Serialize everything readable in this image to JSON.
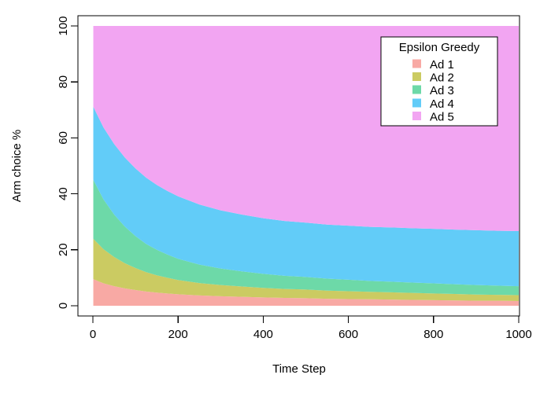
{
  "chart_data": {
    "type": "area",
    "stacked": true,
    "percent": true,
    "title": "",
    "xlabel": "Time Step",
    "ylabel": "Arm choice %",
    "xlim": [
      0,
      1000
    ],
    "ylim": [
      0,
      100
    ],
    "grid": false,
    "xticks": [
      0,
      200,
      400,
      600,
      800,
      1000
    ],
    "yticks": [
      0,
      20,
      40,
      60,
      80,
      100
    ],
    "xtick_labels": [
      "0",
      "200",
      "400",
      "600",
      "800",
      "1000"
    ],
    "ytick_labels": [
      "0",
      "20",
      "40",
      "60",
      "80",
      "100"
    ],
    "legend": {
      "title": "Epsilon Greedy",
      "position": "top-right",
      "entries": [
        {
          "label": "Ad 1",
          "color": "#F8A9A4"
        },
        {
          "label": "Ad 2",
          "color": "#CBCB62"
        },
        {
          "label": "Ad 3",
          "color": "#6DD9A8"
        },
        {
          "label": "Ad 4",
          "color": "#62CCF8"
        },
        {
          "label": "Ad 5",
          "color": "#F2A5F2"
        }
      ]
    },
    "x": [
      1,
      25,
      50,
      75,
      100,
      125,
      150,
      175,
      200,
      250,
      300,
      350,
      400,
      450,
      500,
      550,
      600,
      650,
      700,
      750,
      800,
      850,
      900,
      950,
      1000
    ],
    "series": [
      {
        "name": "Ad 1",
        "color": "#F8A9A4",
        "values": [
          9.5,
          8.0,
          7.0,
          6.2,
          5.6,
          5.1,
          4.7,
          4.4,
          4.1,
          3.7,
          3.4,
          3.2,
          3.0,
          2.8,
          2.7,
          2.5,
          2.4,
          2.3,
          2.2,
          2.1,
          2.0,
          1.9,
          1.8,
          1.8,
          1.7
        ]
      },
      {
        "name": "Ad 2",
        "color": "#CBCB62",
        "values": [
          14.4,
          12.2,
          10.4,
          9.0,
          7.9,
          6.9,
          6.2,
          5.6,
          5.1,
          4.4,
          4.0,
          3.7,
          3.4,
          3.2,
          3.1,
          2.9,
          2.8,
          2.7,
          2.6,
          2.5,
          2.4,
          2.3,
          2.2,
          2.1,
          2.1
        ]
      },
      {
        "name": "Ad 3",
        "color": "#6DD9A8",
        "values": [
          21.1,
          17.8,
          15.2,
          13.1,
          11.4,
          10.1,
          9.1,
          8.3,
          7.6,
          6.6,
          5.9,
          5.4,
          5.0,
          4.7,
          4.5,
          4.3,
          4.1,
          3.9,
          3.8,
          3.7,
          3.6,
          3.5,
          3.4,
          3.3,
          3.2
        ]
      },
      {
        "name": "Ad 4",
        "color": "#62CCF8",
        "values": [
          26.1,
          25.7,
          25.2,
          24.7,
          24.2,
          23.7,
          23.2,
          22.7,
          22.3,
          21.5,
          20.8,
          20.3,
          19.9,
          19.6,
          19.4,
          19.3,
          19.3,
          19.3,
          19.4,
          19.4,
          19.5,
          19.5,
          19.6,
          19.6,
          19.7
        ]
      },
      {
        "name": "Ad 5",
        "color": "#F2A5F2",
        "values": [
          28.9,
          36.3,
          42.2,
          47.0,
          50.9,
          54.2,
          56.8,
          59.0,
          60.9,
          63.8,
          65.9,
          67.4,
          68.7,
          69.7,
          70.3,
          71.0,
          71.4,
          71.8,
          72.0,
          72.3,
          72.5,
          72.8,
          73.0,
          73.2,
          73.3
        ]
      }
    ]
  },
  "axes": {
    "x_title": "Time Step",
    "y_title": "Arm choice %"
  }
}
